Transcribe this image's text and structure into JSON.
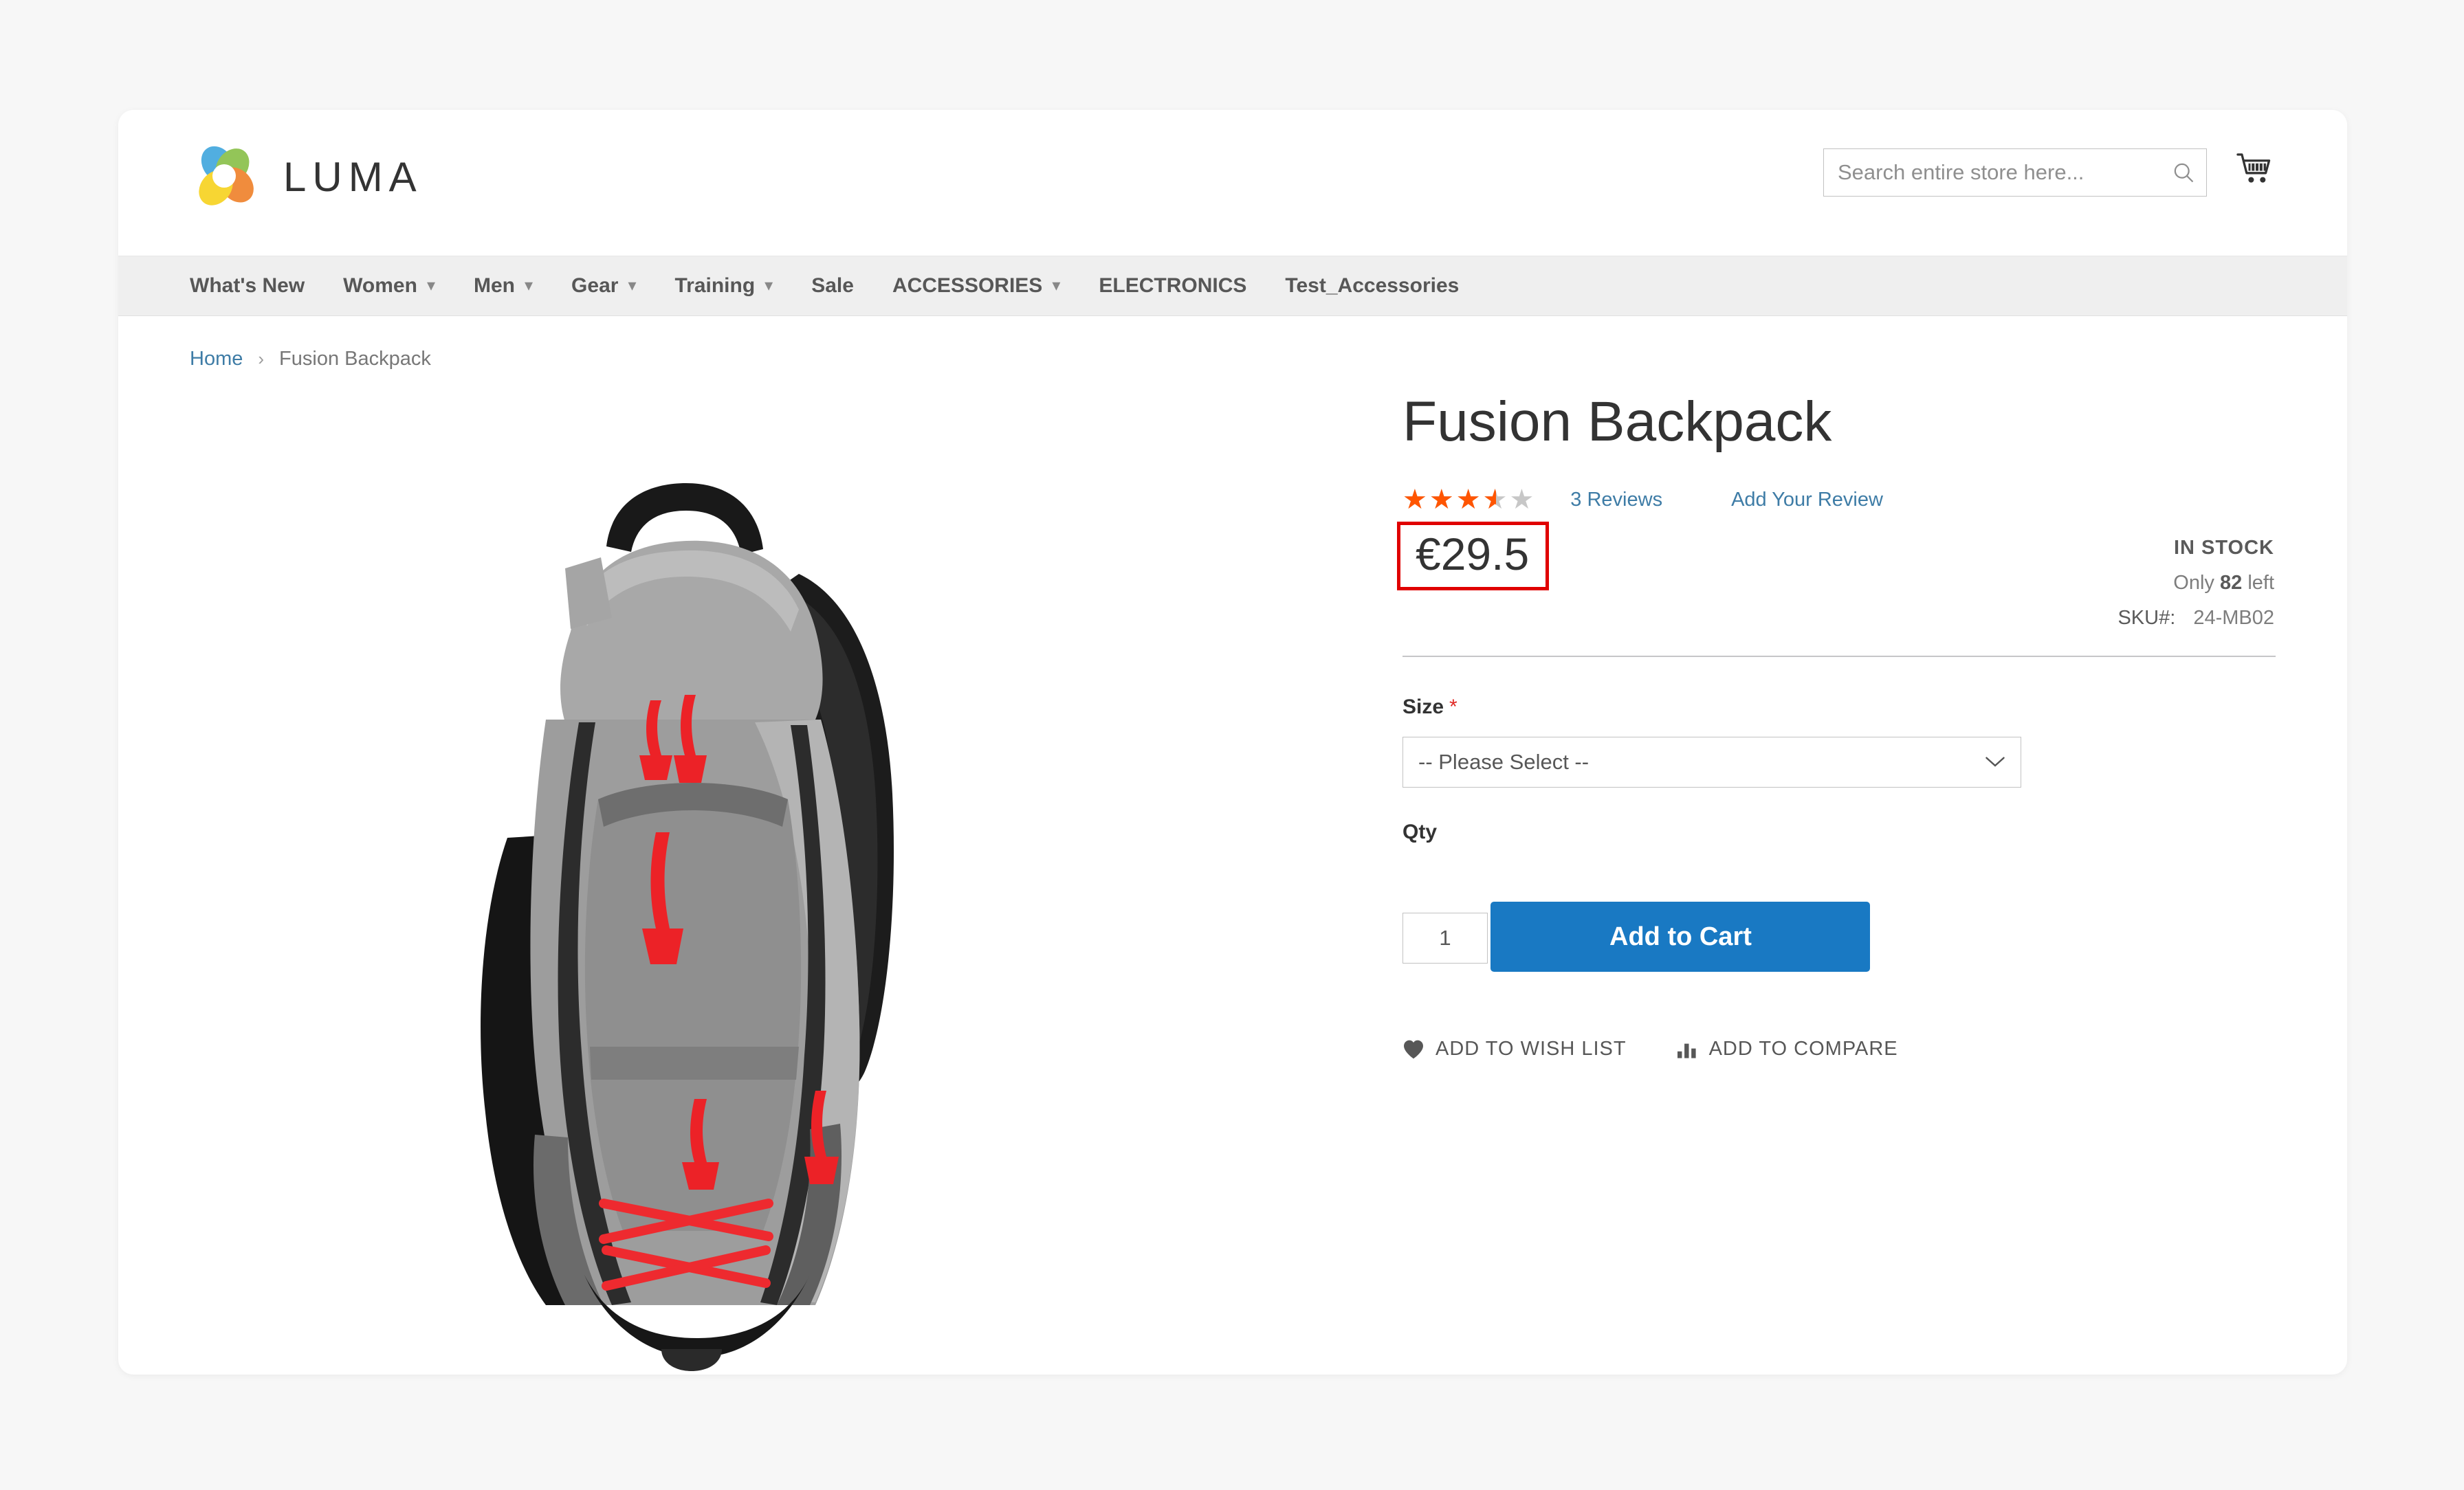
{
  "header": {
    "brand": "LUMA",
    "search": {
      "placeholder": "Search entire store here...",
      "value": "",
      "icon": "search-icon"
    },
    "cart": {
      "icon": "shopping-cart-icon"
    }
  },
  "nav": {
    "items": [
      {
        "label": "What's New",
        "has_chevron": false
      },
      {
        "label": "Women",
        "has_chevron": true
      },
      {
        "label": "Men",
        "has_chevron": true
      },
      {
        "label": "Gear",
        "has_chevron": true
      },
      {
        "label": "Training",
        "has_chevron": true
      },
      {
        "label": "Sale",
        "has_chevron": false
      },
      {
        "label": "ACCESSORIES",
        "has_chevron": true
      },
      {
        "label": "ELECTRONICS",
        "has_chevron": false
      },
      {
        "label": "Test_Accessories",
        "has_chevron": false
      }
    ]
  },
  "breadcrumb": {
    "home": "Home",
    "separator": "›",
    "current": "Fusion Backpack"
  },
  "product": {
    "title": "Fusion Backpack",
    "rating": {
      "value": 3.5,
      "max": 5,
      "percent": 70,
      "stars_glyphs": "★★★★★",
      "reviews_label": "3  Reviews",
      "add_review_label": "Add Your Review",
      "filled_color": "#ff5501",
      "empty_color": "#c7c7c7"
    },
    "price": {
      "display": "€29.5",
      "currency": "€",
      "amount": "29.5",
      "highlight_color": "#e00000"
    },
    "availability": "IN STOCK",
    "stock_prefix": "Only",
    "stock_count": "82",
    "stock_suffix": "left",
    "sku_label": "SKU#:",
    "sku_value": "24-MB02",
    "image_alt": "gray and black fusion backpack with red zipper pulls and bungee cord"
  },
  "options": {
    "size": {
      "label": "Size",
      "required_marker": "*",
      "selected": "-- Please Select --",
      "chevron": "⌄"
    },
    "qty": {
      "label": "Qty",
      "value": "1"
    }
  },
  "actions": {
    "add_to_cart": "Add to Cart",
    "wish_list": "ADD TO WISH LIST",
    "compare": "ADD TO COMPARE"
  },
  "colors": {
    "accent_blue": "#1979c3",
    "link_blue": "#3e7ca6",
    "nav_bg": "#efefef",
    "page_bg": "#f7f7f7",
    "text_dark": "#333333"
  }
}
